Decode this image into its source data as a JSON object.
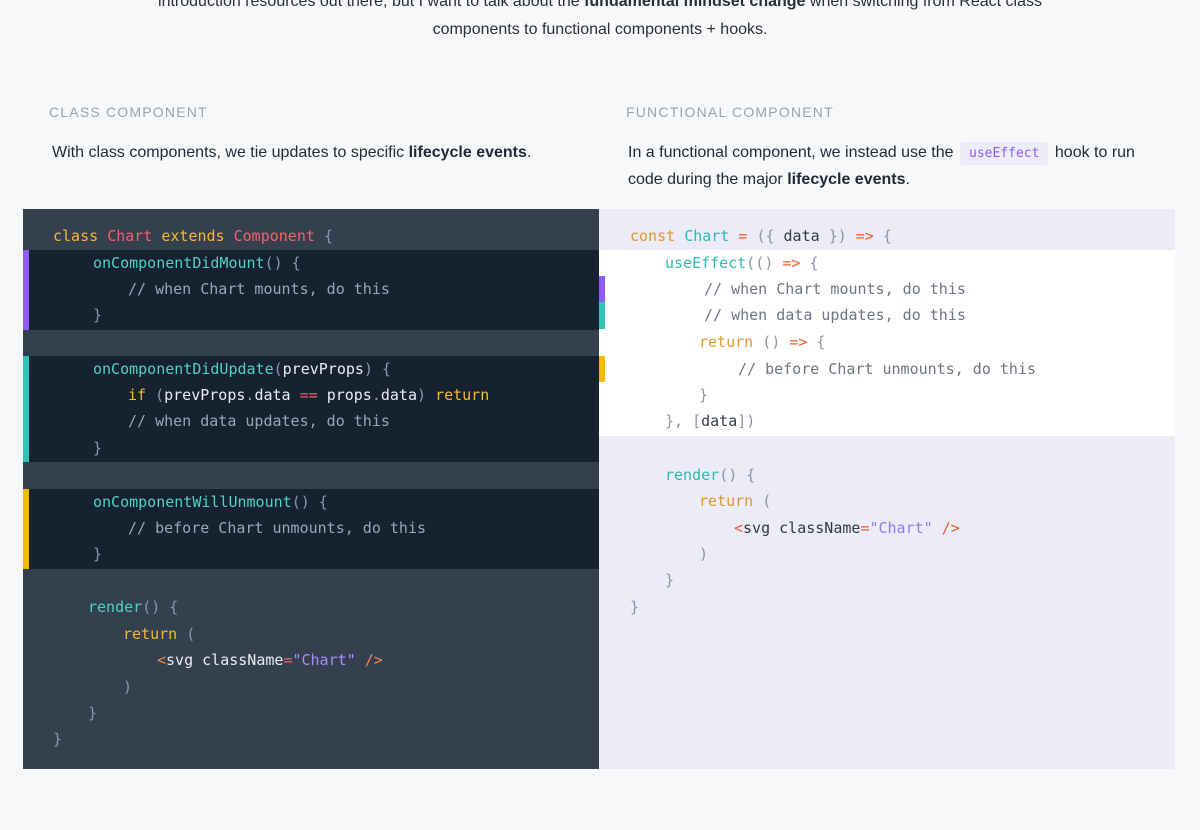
{
  "intro": {
    "line1_before": "introduction resources out there, but I want to talk about the ",
    "line1_bold": "fundamental mindset change",
    "line1_after": " when switching from React class",
    "line2": "components to functional components + hooks."
  },
  "class_section": {
    "label": "CLASS COMPONENT",
    "desc_before": "With class components, we tie updates to specific ",
    "desc_bold": "lifecycle events",
    "desc_after": "."
  },
  "functional_section": {
    "label": "FUNCTIONAL COMPONENT",
    "desc_before": "In a functional component, we instead use the ",
    "desc_code": "useEffect",
    "desc_middle": " hook to run",
    "desc_line2_before": "code during the major ",
    "desc_bold": "lifecycle events",
    "desc_after": "."
  },
  "colors": {
    "mount": "#8b5cf6",
    "update": "#2ec4b6",
    "unmount": "#f5b800"
  },
  "class_code": {
    "l1": {
      "kw_class": "class",
      "name": "Chart",
      "kw_extends": "extends",
      "base": "Component",
      "brace": "{"
    },
    "l2": {
      "fn": "onComponentDidMount",
      "punc": "() {"
    },
    "l3": {
      "comment": "// when Chart mounts, do this"
    },
    "l4": {
      "punc": "}"
    },
    "l5": {
      "fn": "onComponentDidUpdate",
      "open": "(",
      "arg": "prevProps",
      "close": ") {"
    },
    "l6": {
      "kw_if": "if",
      "open": "(",
      "a1": "prevProps",
      "dot1": ".",
      "a2": "data",
      "op": "==",
      "b1": "props",
      "dot2": ".",
      "b2": "data",
      "close": ")",
      "kw_return": "return"
    },
    "l7": {
      "comment": "// when data updates, do this"
    },
    "l8": {
      "punc": "}"
    },
    "l9": {
      "fn": "onComponentWillUnmount",
      "punc": "() {"
    },
    "l10": {
      "comment": "// before Chart unmounts, do this"
    },
    "l11": {
      "punc": "}"
    },
    "l12": {
      "fn": "render",
      "punc": "() {"
    },
    "l13": {
      "kw": "return",
      "punc": "("
    },
    "l14": {
      "lt": "<",
      "tag": "svg",
      "attr": "className",
      "eq": "=",
      "str": "\"Chart\"",
      "end": "/>"
    },
    "l15": {
      "punc": ")"
    },
    "l16": {
      "punc": "}"
    },
    "l17": {
      "punc": "}"
    }
  },
  "func_code": {
    "l1": {
      "kw": "const",
      "name": "Chart",
      "eq": "=",
      "open": "({",
      "arg": "data",
      "close": "})",
      "arrow": "=>",
      "brace": "{"
    },
    "l2": {
      "fn": "useEffect",
      "open": "((",
      "close": ")",
      "arrow": "=>",
      "brace": "{"
    },
    "l3": {
      "comment": "// when Chart mounts, do this"
    },
    "l4": {
      "comment": "// when data updates, do this"
    },
    "l5": {
      "kw": "return",
      "punc": "()",
      "arrow": "=>",
      "brace": "{"
    },
    "l6": {
      "comment": "// before Chart unmounts, do this"
    },
    "l7": {
      "punc": "}"
    },
    "l8": {
      "close": "},",
      "open_b": "[",
      "arg": "data",
      "close_b": "])"
    },
    "l9": {
      "fn": "render",
      "punc": "() {"
    },
    "l10": {
      "kw": "return",
      "punc": "("
    },
    "l11": {
      "lt": "<",
      "tag": "svg",
      "attr": "className",
      "eq": "=",
      "str": "\"Chart\"",
      "end": "/>"
    },
    "l12": {
      "punc": ")"
    },
    "l13": {
      "punc": "}"
    },
    "l14": {
      "punc": "}"
    }
  }
}
